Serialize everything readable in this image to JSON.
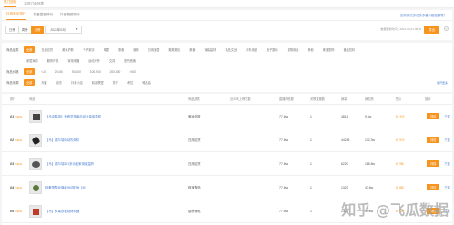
{
  "topnav": [
    "热门团购",
    "实时订单列表"
  ],
  "tabs": [
    "抖音商品排行",
    "抖音直播排行",
    "抖音视频排行"
  ],
  "top_right_link": "如何用达多达多多量价格指数等？",
  "date_segments": [
    "日榜",
    "周榜",
    "月榜"
  ],
  "date_value": "2021年03月",
  "update_text": "数据更新时间：2021-03-01 08:00",
  "export_label": "导出",
  "help_mark": "?",
  "category_label": "商品品类",
  "categories": [
    "全部",
    "日用百货",
    "美妆护肤",
    "个护家清",
    "母婴",
    "零食",
    "服饰",
    "日用家居",
    "鞋靴箱包",
    "美食",
    "家装建材",
    "礼品文创",
    "汽车用品",
    "电子数码",
    "宠物用品",
    "其他",
    "珠宝配饰",
    "食品饮料",
    "家居家纺",
    "服饰内衣",
    "家用电器",
    "运动户外",
    "文具",
    "图书音像"
  ],
  "price_label": "商品价格",
  "prices": [
    "全部",
    "<10",
    "20-50",
    "50-100",
    "100-200",
    "200-500",
    ">500"
  ],
  "source_label": "商品来源",
  "sources": [
    "全部",
    "淘宝",
    "京东",
    "抖音小店",
    "精选联盟",
    "苏宁",
    "考拉",
    "唯品会"
  ],
  "more_label": "展开更多",
  "table_headers": [
    "排行",
    "商品",
    "商品品类",
    "近30天上榜次数",
    "直播商品数",
    "关联直播数",
    "销量",
    "销售额",
    "售价",
    "操作"
  ],
  "rows": [
    {
      "rank": "01",
      "tag": "NEW",
      "name": "【马克善用】营养学指南自动计量体重秤",
      "cat": "美妆护肤",
      "a": "",
      "b": "77.6w",
      "c": "1",
      "sales": "4814",
      "amount": "9.6w",
      "price": "¥ 19.9",
      "btn": "详情",
      "link": "下载"
    },
    {
      "rank": "02",
      "tag": "NEW",
      "name": "【马】德尔瑞电动吹风机",
      "cat": "日用百货",
      "a": "",
      "b": "77.6w",
      "c": "1",
      "sales": "44243",
      "amount": "132.3w",
      "price": "¥ 29.9",
      "btn": "详情",
      "link": "下载"
    },
    {
      "rank": "03",
      "tag": "NEW",
      "name": "【马】德尔瑞301多功能家用保温杯",
      "cat": "日用百货",
      "a": "",
      "b": "77.6w",
      "c": "1",
      "sales": "6220",
      "amount": "185.8w",
      "price": "¥ 298",
      "btn": "详情",
      "link": "下载"
    },
    {
      "rank": "04",
      "tag": "NEW",
      "name": "轻奢男表经典款运动时尚【M】",
      "cat": "珠宝配饰",
      "a": "",
      "b": "77.6w",
      "c": "1",
      "sales": "1323",
      "amount": "47.6w",
      "price": "¥ 358",
      "btn": "详情",
      "link": "下载"
    },
    {
      "rank": "05",
      "tag": "NEW",
      "name": "【马】水果铁板烧烤机器",
      "cat": "厨房家电",
      "a": "",
      "b": "77.6w",
      "c": "1",
      "sales": "1323",
      "amount": "47.6w",
      "price": "¥ 358",
      "btn": "详情",
      "link": "下载"
    }
  ],
  "watermark": "知乎 @飞瓜数据"
}
